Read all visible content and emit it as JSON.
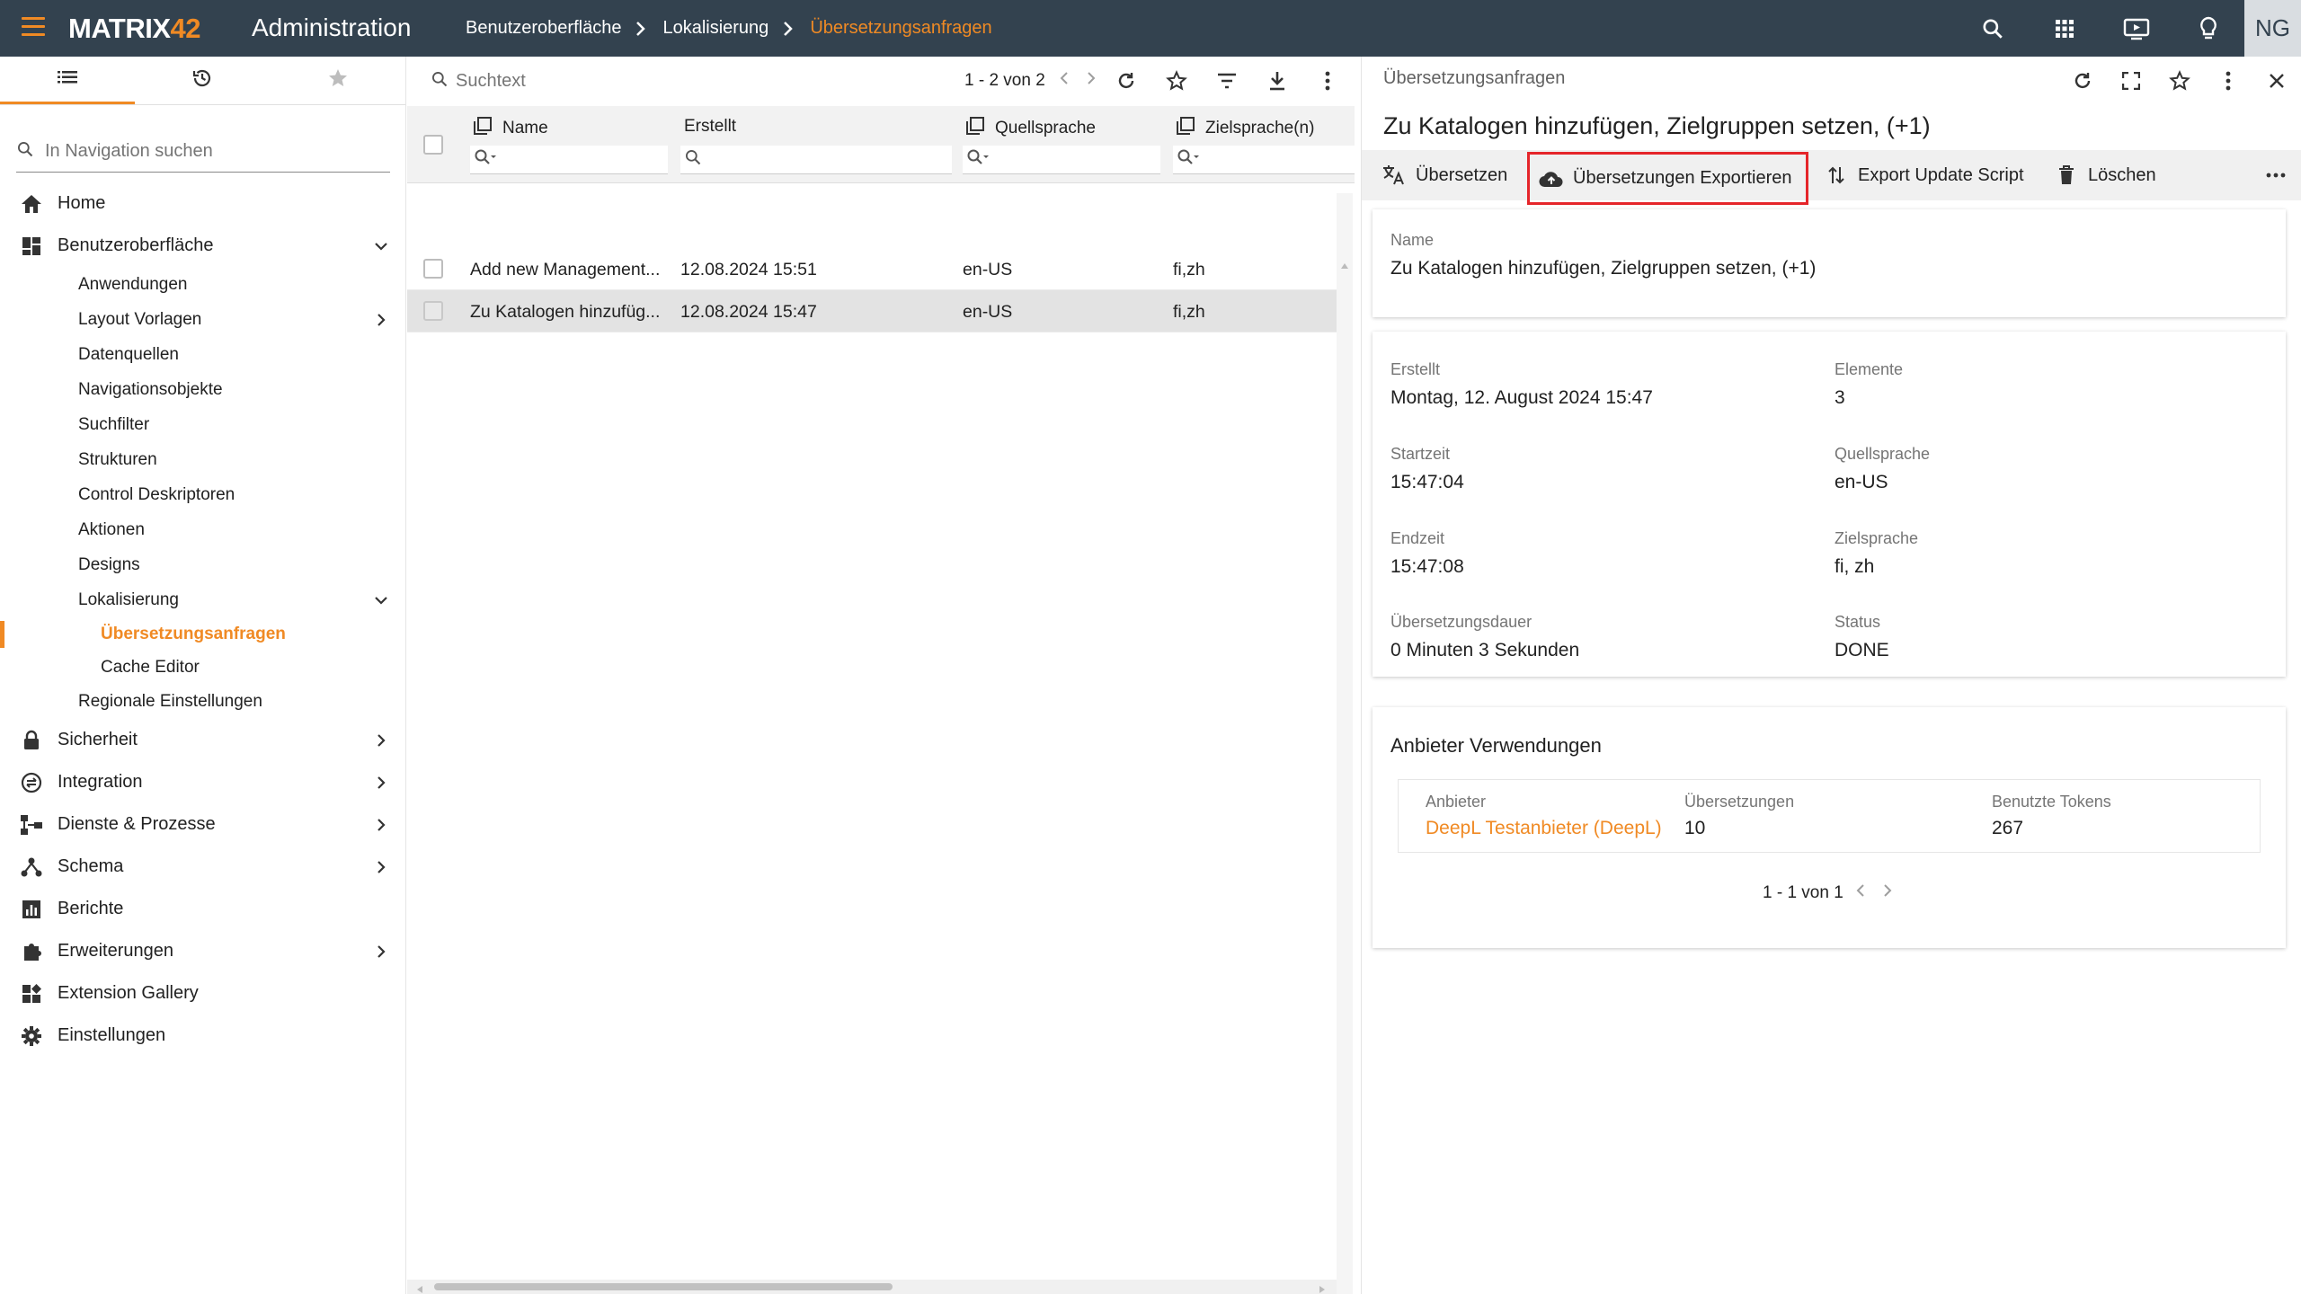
{
  "topbar": {
    "logo_main": "MATRIX",
    "logo_num": "42",
    "app_title": "Administration",
    "breadcrumb": [
      "Benutzeroberfläche",
      "Lokalisierung",
      "Übersetzungsanfragen"
    ],
    "avatar": "NG",
    "icons": [
      "search-icon",
      "apps-grid-icon",
      "presentation-icon",
      "lightbulb-icon"
    ]
  },
  "leftnav": {
    "tabs": [
      "list-icon",
      "history-icon",
      "star-icon"
    ],
    "search_placeholder": "In Navigation suchen",
    "items": {
      "home": "Home",
      "benutzeroberflaeche": "Benutzeroberfläche",
      "anwendungen": "Anwendungen",
      "layout_vorlagen": "Layout Vorlagen",
      "datenquellen": "Datenquellen",
      "navigationsobjekte": "Navigationsobjekte",
      "suchfilter": "Suchfilter",
      "strukturen": "Strukturen",
      "control_deskriptoren": "Control Deskriptoren",
      "aktionen": "Aktionen",
      "designs": "Designs",
      "lokalisierung": "Lokalisierung",
      "uebersetzungsanfragen": "Übersetzungsanfragen",
      "cache_editor": "Cache Editor",
      "regionale_einstellungen": "Regionale Einstellungen",
      "sicherheit": "Sicherheit",
      "integration": "Integration",
      "dienste_prozesse": "Dienste & Prozesse",
      "schema": "Schema",
      "berichte": "Berichte",
      "erweiterungen": "Erweiterungen",
      "extension_gallery": "Extension Gallery",
      "einstellungen": "Einstellungen"
    }
  },
  "list": {
    "search_placeholder": "Suchtext",
    "pager": "1 - 2 von 2",
    "columns": {
      "name": "Name",
      "erstellt": "Erstellt",
      "quellsprache": "Quellsprache",
      "zielsprache": "Zielsprache(n)"
    },
    "rows": [
      {
        "name": "Add new Management...",
        "erstellt": "12.08.2024 15:51",
        "quell": "en-US",
        "ziel": "fi,zh"
      },
      {
        "name": "Zu Katalogen hinzufüg...",
        "erstellt": "12.08.2024 15:47",
        "quell": "en-US",
        "ziel": "fi,zh"
      }
    ]
  },
  "detail": {
    "header": "Übersetzungsanfragen",
    "title": "Zu Katalogen hinzufügen, Zielgruppen setzen, (+1)",
    "actions": {
      "uebersetzen": "Übersetzen",
      "exportieren": "Übersetzungen Exportieren",
      "update_script": "Export Update Script",
      "loeschen": "Löschen"
    },
    "name_label": "Name",
    "name_value": "Zu Katalogen hinzufügen, Zielgruppen setzen, (+1)",
    "fields": {
      "erstellt_label": "Erstellt",
      "erstellt_value": "Montag, 12. August 2024 15:47",
      "elemente_label": "Elemente",
      "elemente_value": "3",
      "startzeit_label": "Startzeit",
      "startzeit_value": "15:47:04",
      "quellsprache_label": "Quellsprache",
      "quellsprache_value": "en-US",
      "endzeit_label": "Endzeit",
      "endzeit_value": "15:47:08",
      "zielsprache_label": "Zielsprache",
      "zielsprache_value": "fi, zh",
      "dauer_label": "Übersetzungsdauer",
      "dauer_value": "0 Minuten 3 Sekunden",
      "status_label": "Status",
      "status_value": "DONE"
    },
    "provider": {
      "title": "Anbieter Verwendungen",
      "col_anbieter": "Anbieter",
      "col_uebersetzungen": "Übersetzungen",
      "col_tokens": "Benutzte Tokens",
      "anbieter_value": "DeepL Testanbieter (DeepL)",
      "uebersetzungen_value": "10",
      "tokens_value": "267",
      "pager": "1 - 1 von 1"
    }
  },
  "colors": {
    "accent": "#f08a24",
    "topbar": "#33424f",
    "highlight_border": "#e5252a"
  }
}
